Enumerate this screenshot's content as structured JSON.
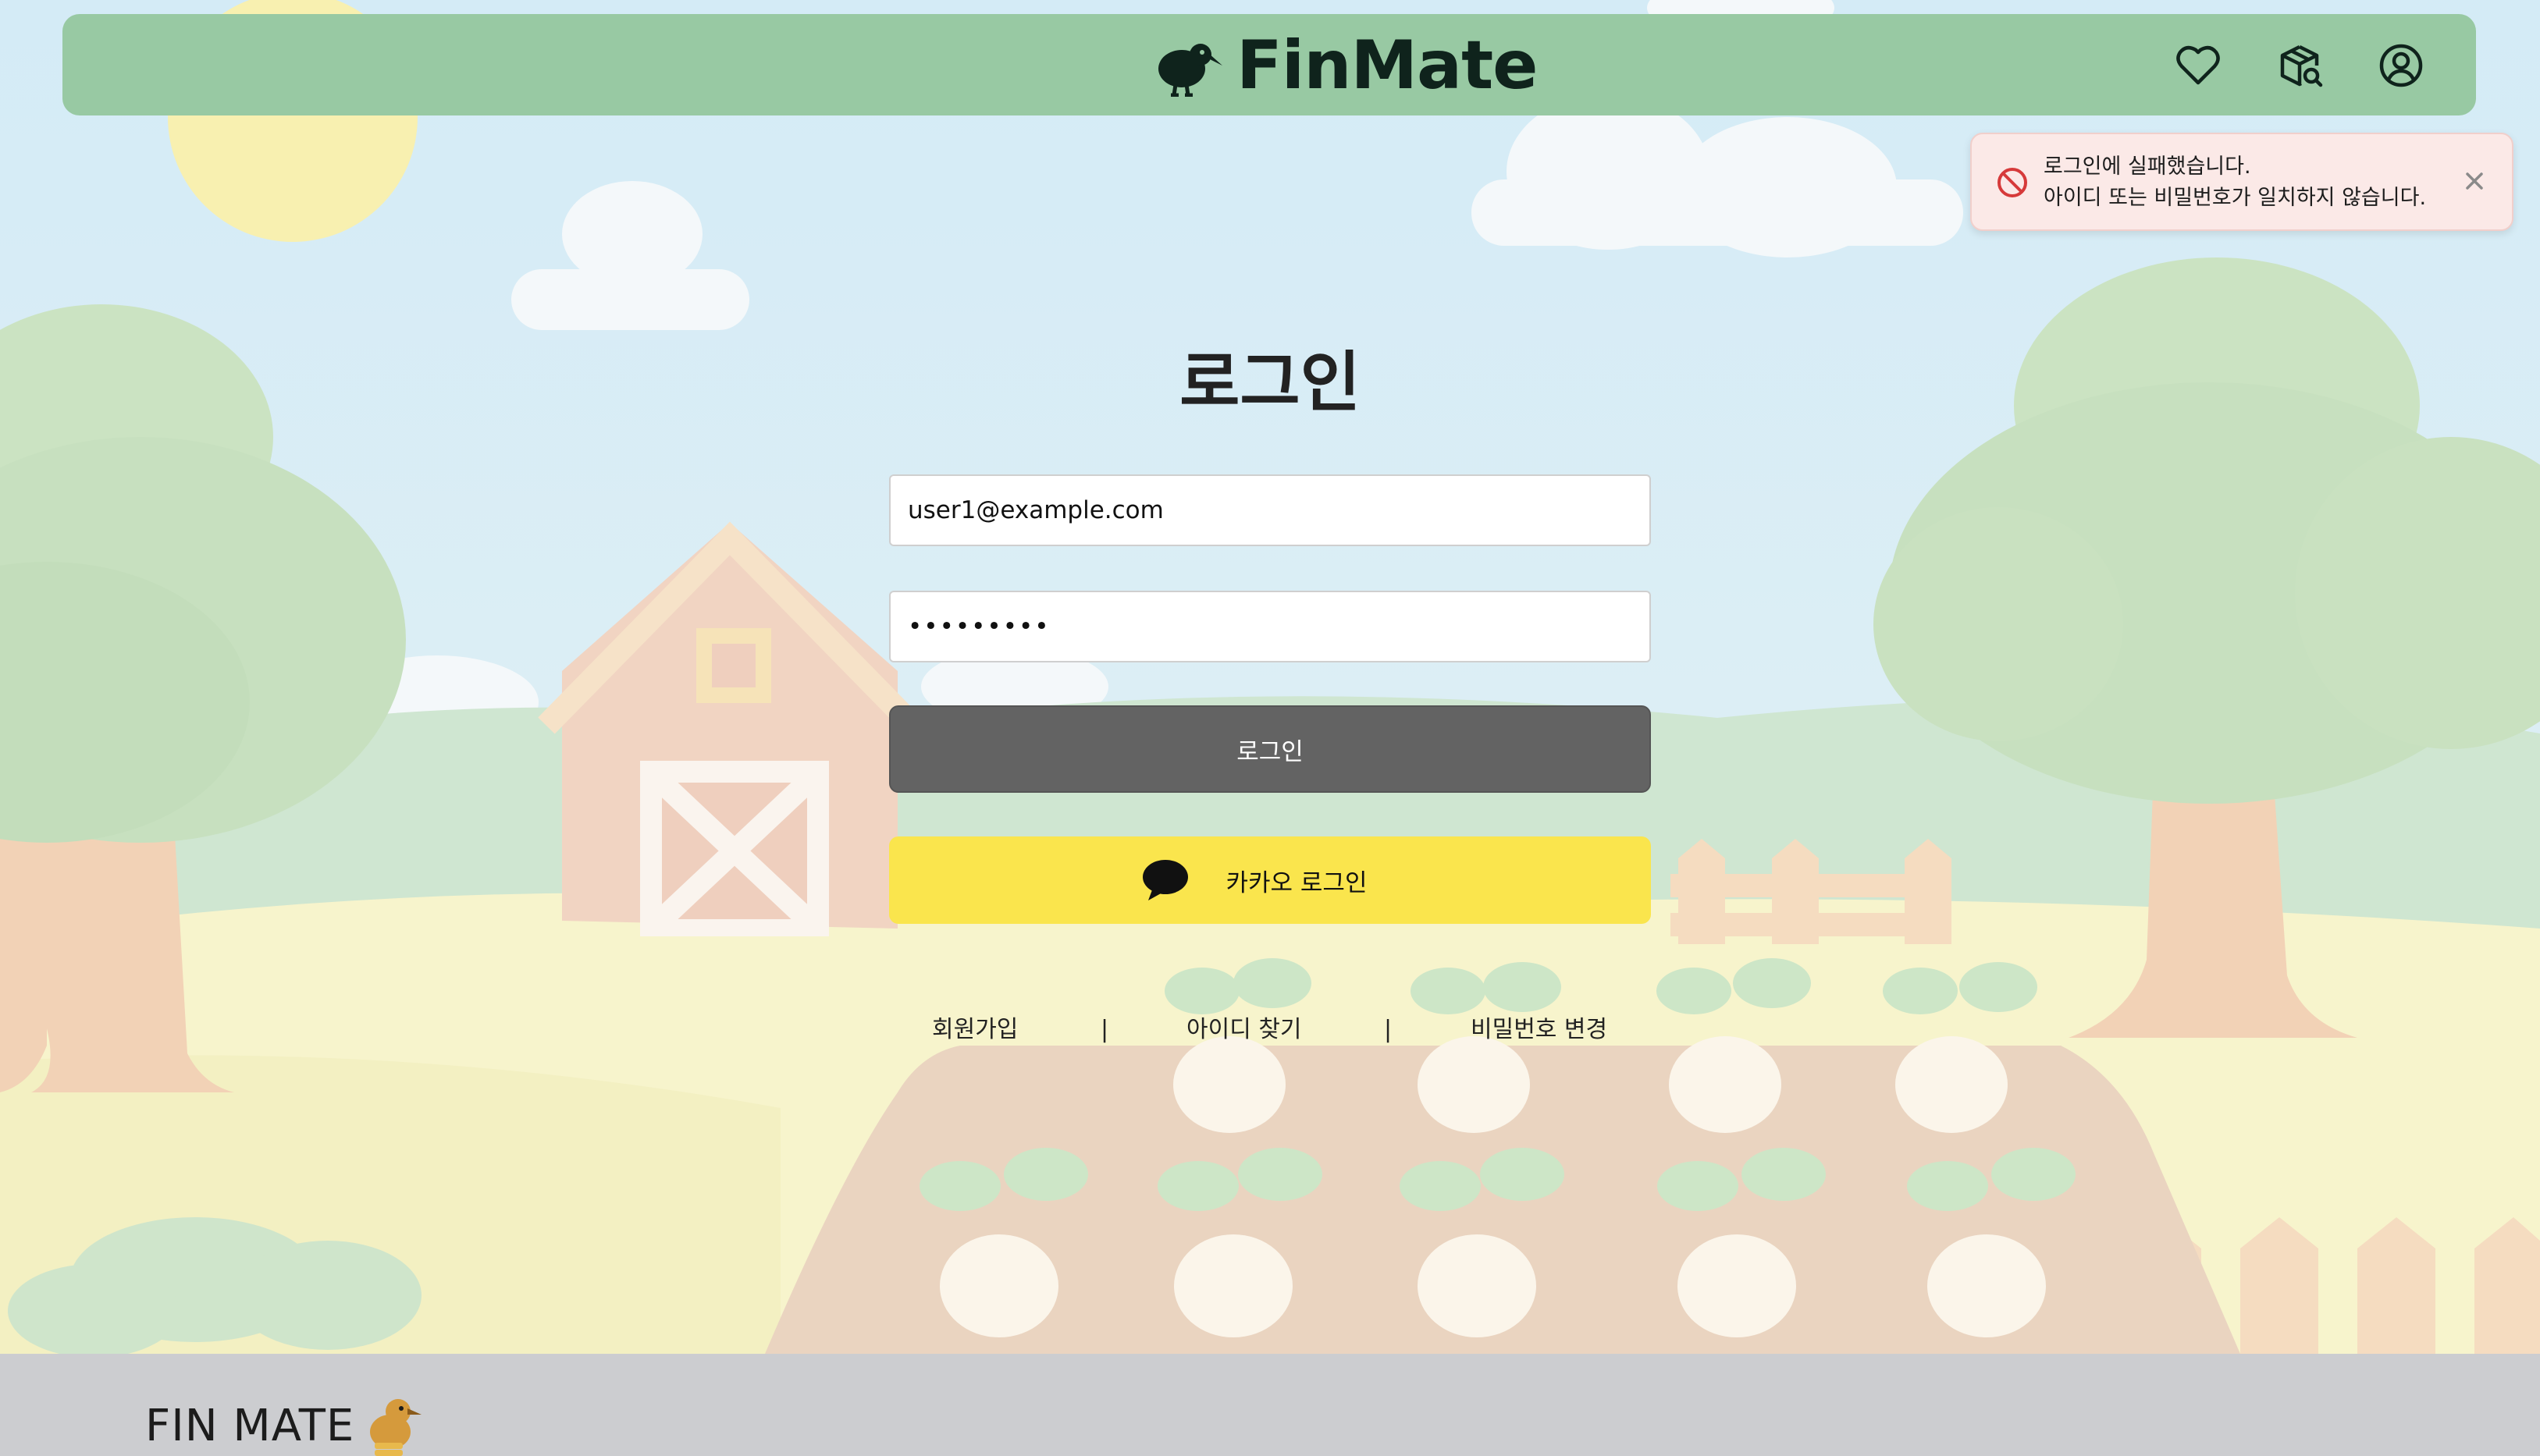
{
  "header": {
    "brand_name": "FinMate",
    "icons": [
      "heart-icon",
      "package-search-icon",
      "user-circle-icon"
    ]
  },
  "toast": {
    "line1": "로그인에 실패했습니다.",
    "line2": "아이디 또는 비밀번호가 일치하지 않습니다.",
    "icon": "ban-icon",
    "close_icon": "close-icon",
    "accent": "#d63a3a"
  },
  "login": {
    "title": "로그인",
    "email_value": "user1@example.com",
    "password_value": "•••••••••",
    "login_button": "로그인",
    "kakao_button": "카카오 로그인"
  },
  "links": {
    "signup": "회원가입",
    "separator": "|",
    "find_id": "아이디 찾기",
    "change_password": "비밀번호 변경"
  },
  "footer": {
    "logo_text": "FIN MATE"
  },
  "colors": {
    "header_bg": "#98c9a3",
    "login_button_bg": "#636363",
    "kakao_button_bg": "#fae54d",
    "footer_bg": "#cccdd0"
  }
}
